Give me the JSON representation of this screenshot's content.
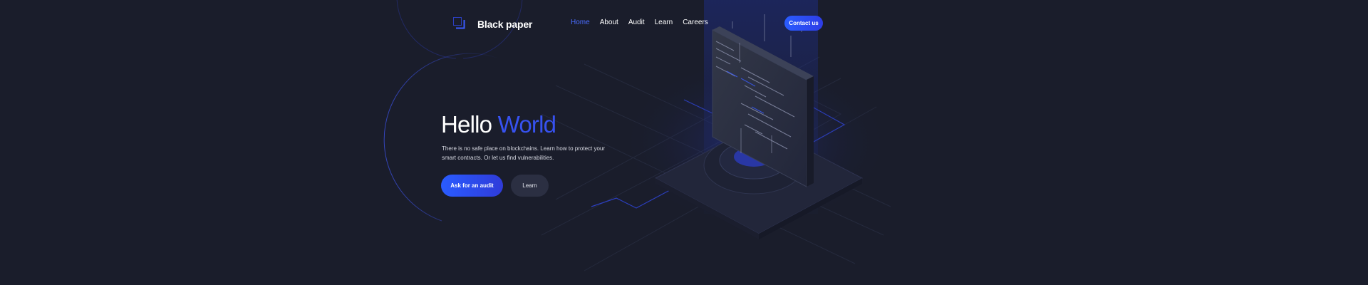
{
  "brand": {
    "name": "Black paper",
    "logo_icon": "corner-square-icon"
  },
  "nav": {
    "items": [
      {
        "label": "Home",
        "active": true
      },
      {
        "label": "About",
        "active": false
      },
      {
        "label": "Audit",
        "active": false
      },
      {
        "label": "Learn",
        "active": false
      },
      {
        "label": "Careers",
        "active": false
      }
    ],
    "contact_label": "Contact us"
  },
  "hero": {
    "title_plain": "Hello",
    "title_accent": "World",
    "description": "There is no safe place on blockchains. Learn how to protect your smart contracts. Or let us find vulnerabilities.",
    "primary_cta": "Ask for an audit",
    "secondary_cta": "Learn"
  },
  "colors": {
    "background": "#1a1d2b",
    "accent": "#3752f0",
    "button_gradient_start": "#2a5cff",
    "secondary_button": "#2b2f42",
    "nav_active": "#4a6cff"
  }
}
